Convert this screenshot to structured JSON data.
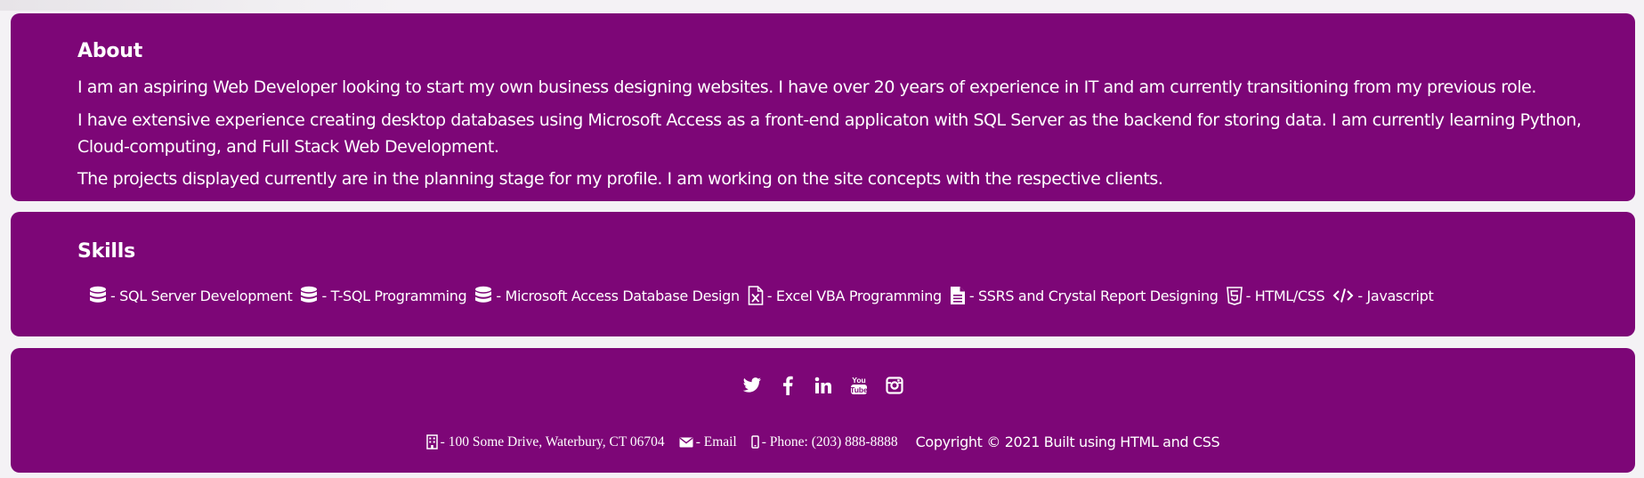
{
  "about": {
    "title": "About",
    "paragraphs": [
      "I am an aspiring Web Developer looking to start my own business designing websites. I have over 20 years of experience in IT and am currently transitioning from my previous role.",
      "I have extensive experience creating desktop databases using Microsoft Access as a front-end applicaton with SQL Server as the backend for storing data. I am currently learning Python, Cloud-computing, and Full Stack Web Development.",
      "The projects displayed currently are in the planning stage for my profile. I am working on the site concepts with the respective clients."
    ]
  },
  "skills": {
    "title": "Skills",
    "items": [
      {
        "icon": "database-icon",
        "label": "- SQL Server Development"
      },
      {
        "icon": "database-icon",
        "label": "- T-SQL Programming"
      },
      {
        "icon": "database-icon",
        "label": "- Microsoft Access Database Design"
      },
      {
        "icon": "excel-file-icon",
        "label": "- Excel VBA Programming"
      },
      {
        "icon": "document-icon",
        "label": "- SSRS and Crystal Report Designing"
      },
      {
        "icon": "html5-icon",
        "label": "- HTML/CSS"
      },
      {
        "icon": "code-icon",
        "label": "- Javascript"
      }
    ]
  },
  "footer": {
    "social": [
      "twitter-icon",
      "facebook-icon",
      "linkedin-icon",
      "youtube-icon",
      "instagram-icon"
    ],
    "address": "- 100 Some Drive, Waterbury, CT 06704",
    "email": "- Email",
    "phone": "- Phone: (203) 888-8888",
    "copyright": "Copyright © 2021 Built using HTML and CSS"
  },
  "colors": {
    "panel": "#7d0677",
    "background": "#f4f2f5",
    "text": "#ffffff"
  }
}
